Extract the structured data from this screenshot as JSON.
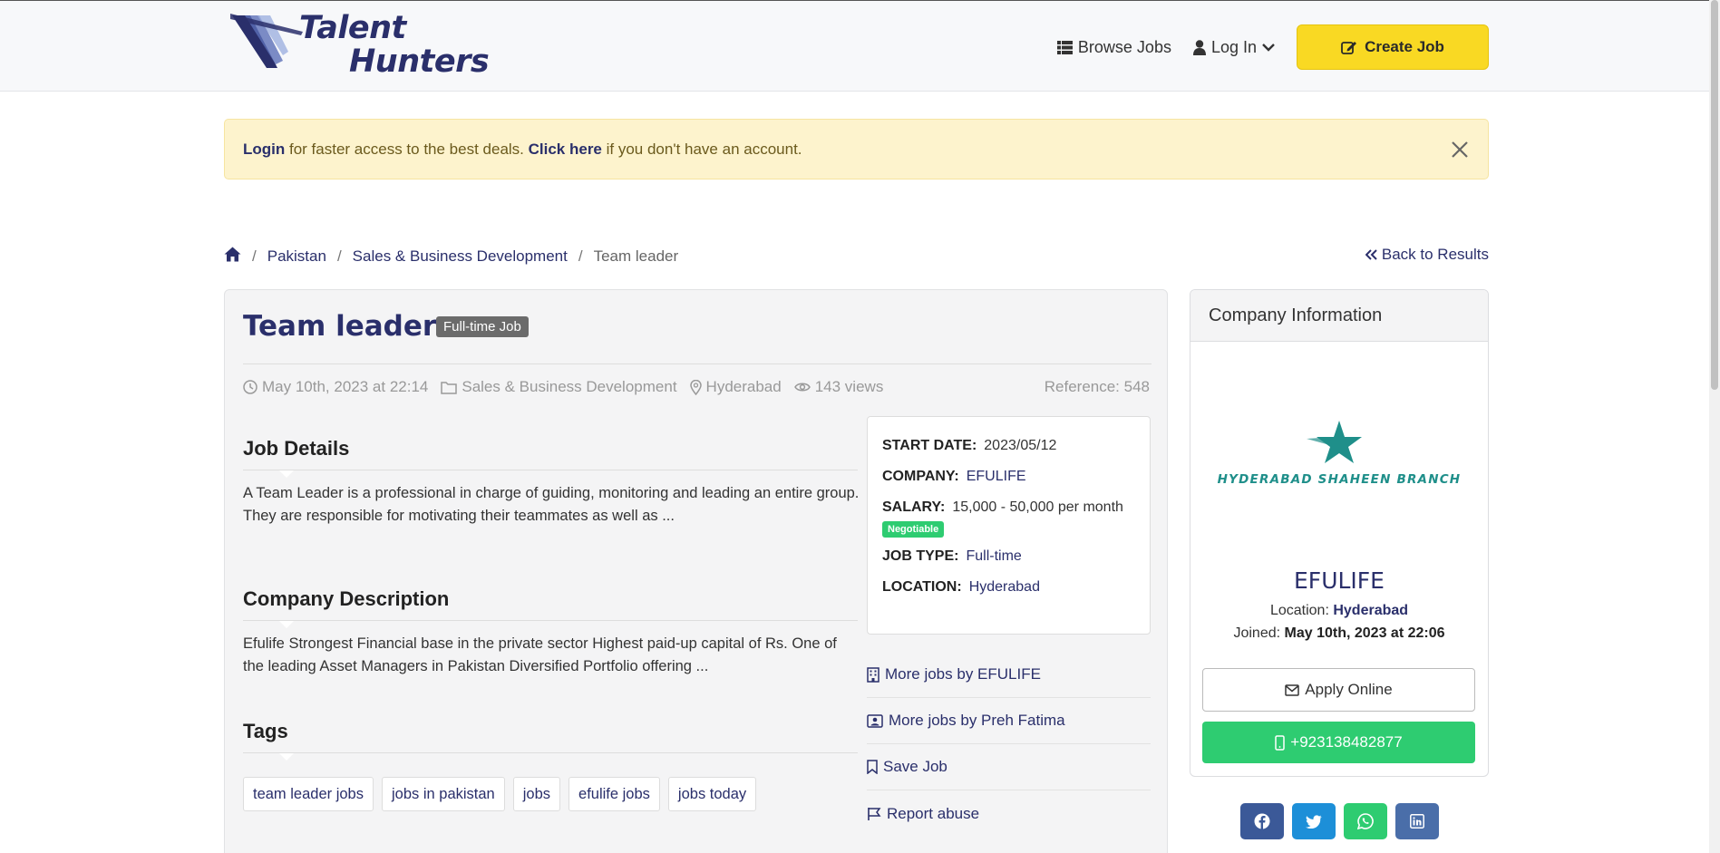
{
  "brand": {
    "line1": "Talent",
    "line2": "Hunters"
  },
  "nav": {
    "browse": "Browse Jobs",
    "login": "Log In",
    "create": "Create Job"
  },
  "alert": {
    "login": "Login",
    "text1": " for faster access to the best deals. ",
    "click": "Click here",
    "text2": " if you don't have an account."
  },
  "breadcrumb": {
    "country": "Pakistan",
    "category": "Sales & Business Development",
    "current": "Team leader",
    "back": "Back to Results"
  },
  "job": {
    "title": "Team leader",
    "badge": "Full-time Job",
    "date": "May 10th, 2023 at 22:14",
    "category": "Sales & Business Development",
    "city": "Hyderabad",
    "views": "143 views",
    "reference": "Reference: 548",
    "details_title": "Job Details",
    "details_text": "A Team Leader is a professional in charge of guiding, monitoring and leading an entire group. They are responsible for motivating their teammates as well as ...",
    "company_title": "Company Description",
    "company_text": "Efulife Strongest Financial base in the private sector Highest paid-up capital of Rs. One of the leading Asset Managers in Pakistan Diversified Portfolio offering ...",
    "tags_title": "Tags",
    "tags": [
      "team leader jobs",
      "jobs in pakistan",
      "jobs",
      "efulife jobs",
      "jobs today"
    ]
  },
  "summary": {
    "start_label": "START DATE:",
    "start_value": "2023/05/12",
    "company_label": "COMPANY:",
    "company_value": "EFULIFE",
    "salary_label": "SALARY:",
    "salary_value": "15,000  -  50,000 per month",
    "negotiable": "Negotiable",
    "type_label": "JOB TYPE:",
    "type_value": "Full-time",
    "location_label": "LOCATION:",
    "location_value": "Hyderabad"
  },
  "links": {
    "more_company": "More jobs by EFULIFE",
    "more_user": "More jobs by Preh Fatima",
    "save": "Save Job",
    "report": "Report abuse"
  },
  "company": {
    "header": "Company Information",
    "logo_text": "HYDERABAD SHAHEEN BRANCH",
    "name": "EFULIFE",
    "location_label": "Location:",
    "location": "Hyderabad",
    "joined_label": "Joined:",
    "joined": "May 10th, 2023 at 22:06",
    "apply": "Apply Online",
    "phone": "+923138482877"
  },
  "colors": {
    "brand": "#2a2f6b",
    "accent": "#f9d923",
    "success": "#2ecc71",
    "facebook": "#3b5998",
    "twitter": "#1da1f2",
    "whatsapp": "#25d366",
    "linkedin": "#4a6ea9"
  }
}
